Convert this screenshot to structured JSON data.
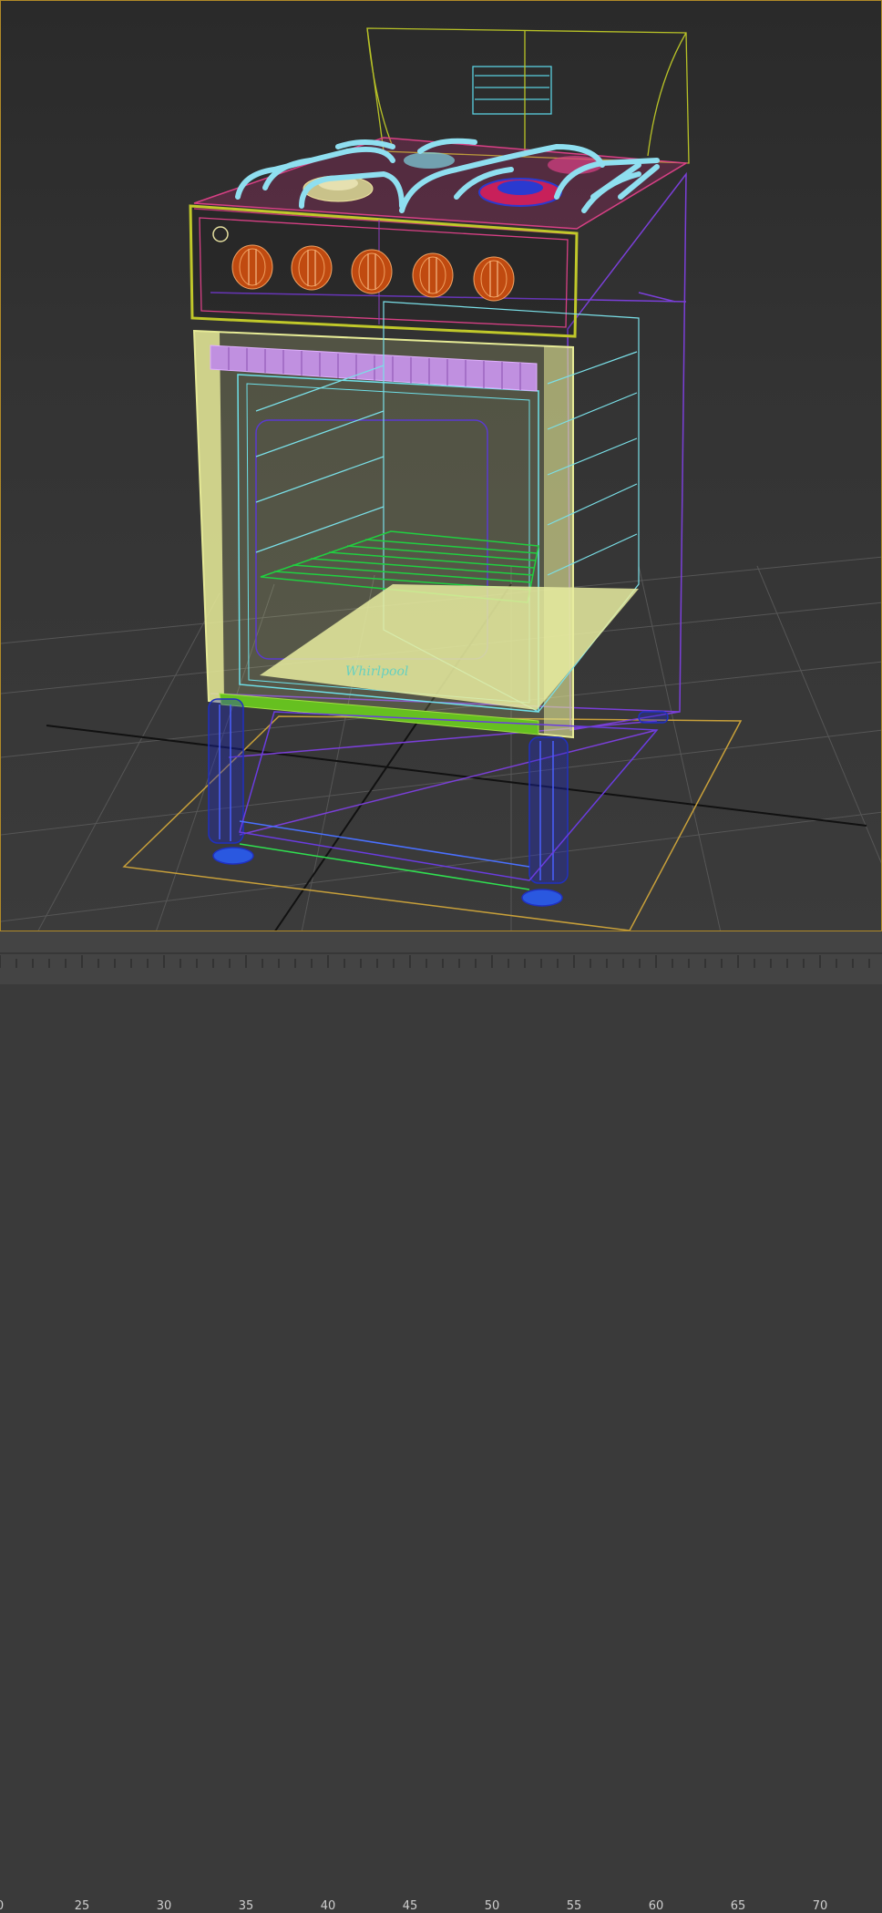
{
  "viewport": {
    "background_top": "#2a2a2a",
    "background_bottom": "#3b3b3b",
    "border_color": "#b08a28",
    "grid_color": "#555555"
  },
  "model": {
    "brand_text": "Whirlpool",
    "knob_count": 5
  },
  "track_bar": {
    "tick_labels": [
      "0",
      "25",
      "30",
      "35",
      "40",
      "45",
      "50",
      "55",
      "60",
      "65",
      "70"
    ]
  }
}
